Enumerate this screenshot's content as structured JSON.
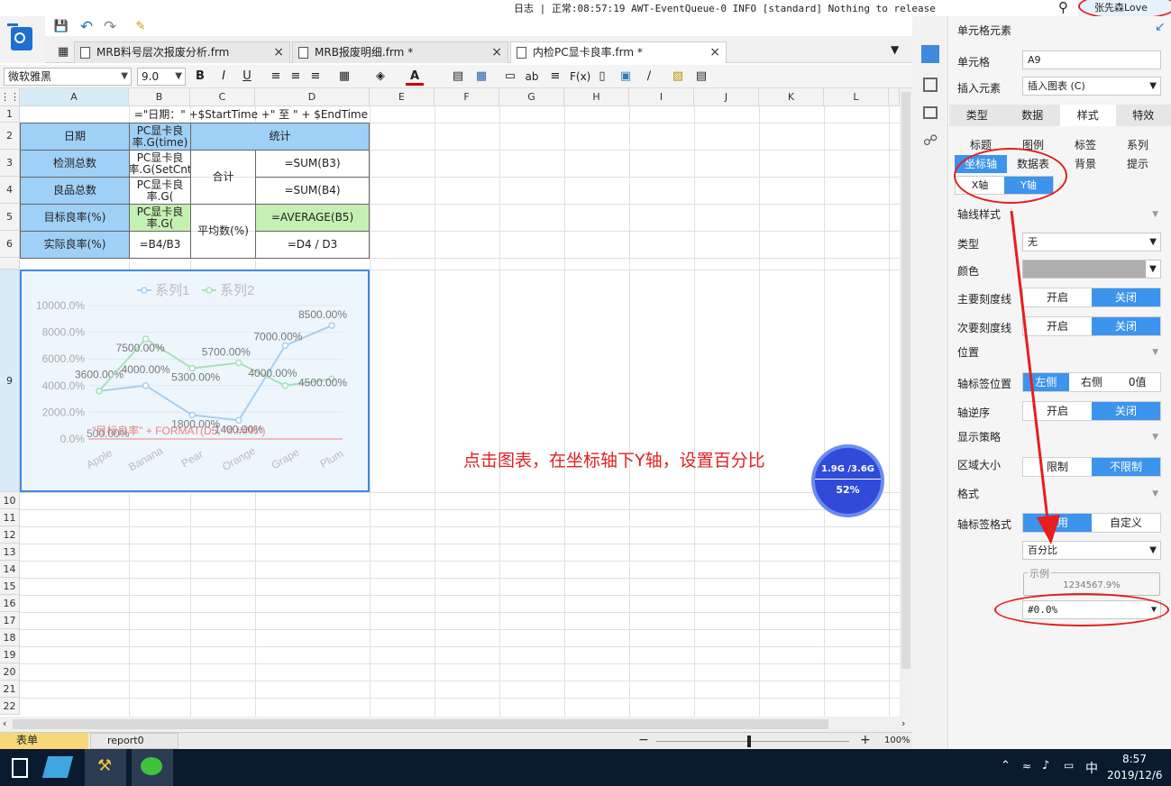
{
  "topbar": {
    "log": "日志 | 正常:08:57:19 AWT-EventQueue-0 INFO [standard] Nothing to release",
    "user": "张先森Love"
  },
  "tabs": [
    {
      "label": "MRB料号层次报废分析.frm"
    },
    {
      "label": "MRB报废明细.frm *"
    },
    {
      "label": "内检PC显卡良率.frm *"
    }
  ],
  "toolbar": {
    "font": "微软雅黑",
    "size": "9.0"
  },
  "columns": [
    "A",
    "B",
    "C",
    "D",
    "E",
    "F",
    "G",
    "H",
    "I",
    "J",
    "K",
    "L"
  ],
  "rows": [
    "1",
    "2",
    "3",
    "4",
    "5",
    "6",
    "",
    "9",
    "10",
    "11",
    "12",
    "13",
    "14",
    "15",
    "16",
    "17",
    "18",
    "19",
    "20",
    "21",
    "22"
  ],
  "cells": {
    "r1": "=\"日期：\" +$StartTime +\" 至 \" + $EndTime",
    "a2": "日期",
    "b2": "PC显卡良率.G(time)",
    "cd2": "统计",
    "a3": "检测总数",
    "b3": "PC显卡良率.G(SetCnt",
    "c34": "合计",
    "d3": "=SUM(B3)",
    "a4": "良品总数",
    "b4": "PC显卡良率.G(",
    "d4": "=SUM(B4)",
    "a5": "目标良率(%)",
    "b5": "PC显卡良率.G(",
    "c56": "平均数(%)",
    "d5": "=AVERAGE(B5)",
    "a6": "实际良率(%)",
    "b6": "=B4/B3",
    "d6": "=D4 / D3"
  },
  "chart_data": {
    "type": "line",
    "categories": [
      "Apple",
      "Banana",
      "Pear",
      "Orange",
      "Grape",
      "Plum"
    ],
    "series": [
      {
        "name": "系列1",
        "values": [
          3600,
          4000,
          1800,
          1400,
          7000,
          8500
        ],
        "labels": [
          "3600.00%",
          "4000.00%",
          "1800.00%",
          "1400.00%",
          "7000.00%",
          "8500.00%"
        ],
        "color": "#a6cfee"
      },
      {
        "name": "系列2",
        "values": [
          3600,
          7500,
          5300,
          5700,
          4000,
          4500
        ],
        "labels": [
          "",
          "7500.00%",
          "5300.00%",
          "5700.00%",
          "4000.00%",
          "4500.00%"
        ],
        "color": "#a8e0bc"
      }
    ],
    "y_ticks": [
      "0.0%",
      "2000.0%",
      "4000.0%",
      "6000.0%",
      "8000.0%",
      "10000.0%"
    ],
    "ylim": [
      0,
      10000
    ],
    "target_label": "\"目标良率\" + FORMAT(D5, \"#.##%\")",
    "extra_label": "500.00%",
    "target_color": "#f08080",
    "legend": "top-center"
  },
  "annotation": "点击图表，在坐标轴下Y轴，设置百分比",
  "memory": {
    "usage": "1.9G /3.6G",
    "percent": "52%"
  },
  "sheet_tabs": [
    "表单",
    "report0"
  ],
  "zoom": "100%",
  "panel": {
    "title": "单元格元素",
    "cell_label": "单元格",
    "cell_value": "A9",
    "insert_label": "插入元素",
    "insert_value": "插入图表 (C)",
    "tabs": [
      "类型",
      "数据",
      "样式",
      "特效"
    ],
    "subtabs1": [
      "标题",
      "图例",
      "标签",
      "系列"
    ],
    "subtabs2": [
      "坐标轴",
      "数据表",
      "背景",
      "提示"
    ],
    "axis_tabs": [
      "X轴",
      "Y轴"
    ],
    "sec_axisline": "轴线样式",
    "type_label": "类型",
    "type_value": "无",
    "color_label": "颜色",
    "major_tick": "主要刻度线",
    "minor_tick": "次要刻度线",
    "on": "开启",
    "off": "关闭",
    "sec_position": "位置",
    "label_pos": "轴标签位置",
    "left": "左侧",
    "right": "右侧",
    "zero": "0值",
    "reverse": "轴逆序",
    "sec_strategy": "显示策略",
    "area_size": "区域大小",
    "limit": "限制",
    "nolimit": "不限制",
    "sec_format": "格式",
    "label_format": "轴标签格式",
    "general": "通用",
    "custom": "自定义",
    "format_type": "百分比",
    "example_label": "示例",
    "example_value": "1234567.9%",
    "pattern": "#0.0%"
  },
  "taskbar": {
    "ime": "中",
    "time": "8:57",
    "date": "2019/12/6"
  }
}
